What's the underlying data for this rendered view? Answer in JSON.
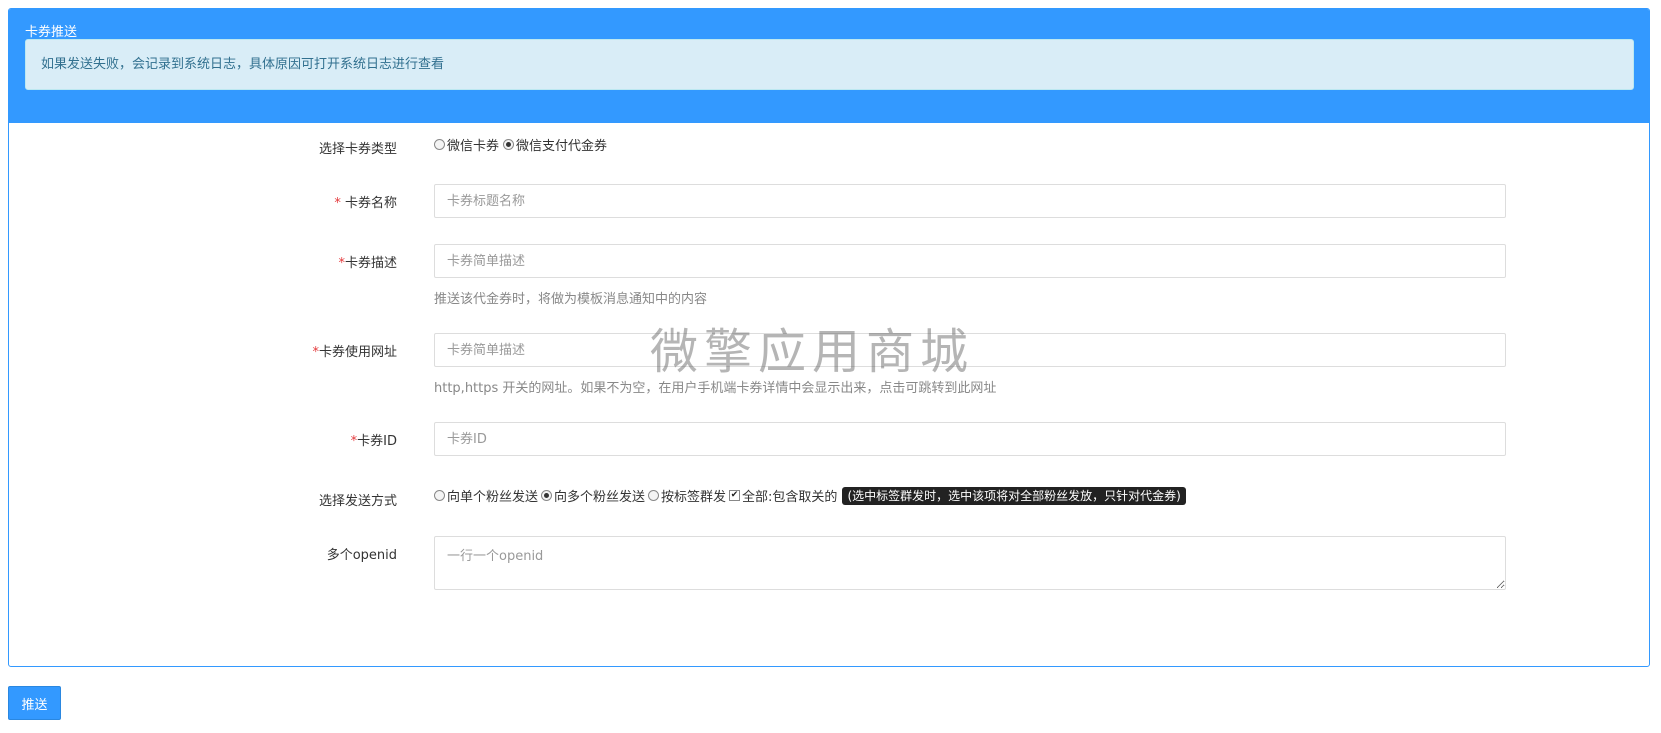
{
  "panel": {
    "title": "卡券推送",
    "alert": "如果发送失败，会记录到系统日志，具体原因可打开系统日志进行查看"
  },
  "form": {
    "coupon_type": {
      "label": "选择卡券类型",
      "options": [
        "微信卡券",
        "微信支付代金券"
      ],
      "selected": "微信支付代金券"
    },
    "coupon_name": {
      "required_mark": "*",
      "label": "卡券名称",
      "placeholder": "卡券标题名称",
      "value": ""
    },
    "coupon_desc": {
      "required_mark": "*",
      "label": "卡券描述",
      "placeholder": "卡券简单描述",
      "value": "",
      "help": "推送该代金券时，将做为模板消息通知中的内容"
    },
    "coupon_url": {
      "required_mark": "*",
      "label": "卡券使用网址",
      "placeholder": "卡券简单描述",
      "value": "",
      "help": "http,https 开关的网址。如果不为空，在用户手机端卡券详情中会显示出来，点击可跳转到此网址"
    },
    "coupon_id": {
      "required_mark": "*",
      "label": "卡券ID",
      "placeholder": "卡券ID",
      "value": ""
    },
    "send_method": {
      "label": "选择发送方式",
      "options": [
        "向单个粉丝发送",
        "向多个粉丝发送",
        "按标签群发"
      ],
      "selected": "向多个粉丝发送",
      "include_all_label": "全部:包含取关的",
      "include_all_checked": true,
      "tip": "(选中标签群发时，选中该项将对全部粉丝发放，只针对代金券)"
    },
    "openids": {
      "label": "多个openid",
      "placeholder": "一行一个openid",
      "value": ""
    }
  },
  "watermark": "微擎应用商城",
  "submit_label": "推送",
  "colors": {
    "primary": "#3399ff",
    "alert_bg": "#d9edf7",
    "alert_text": "#31708f",
    "required": "#e4393c"
  },
  "icons": {
    "checkbox_checked": "check-icon"
  }
}
